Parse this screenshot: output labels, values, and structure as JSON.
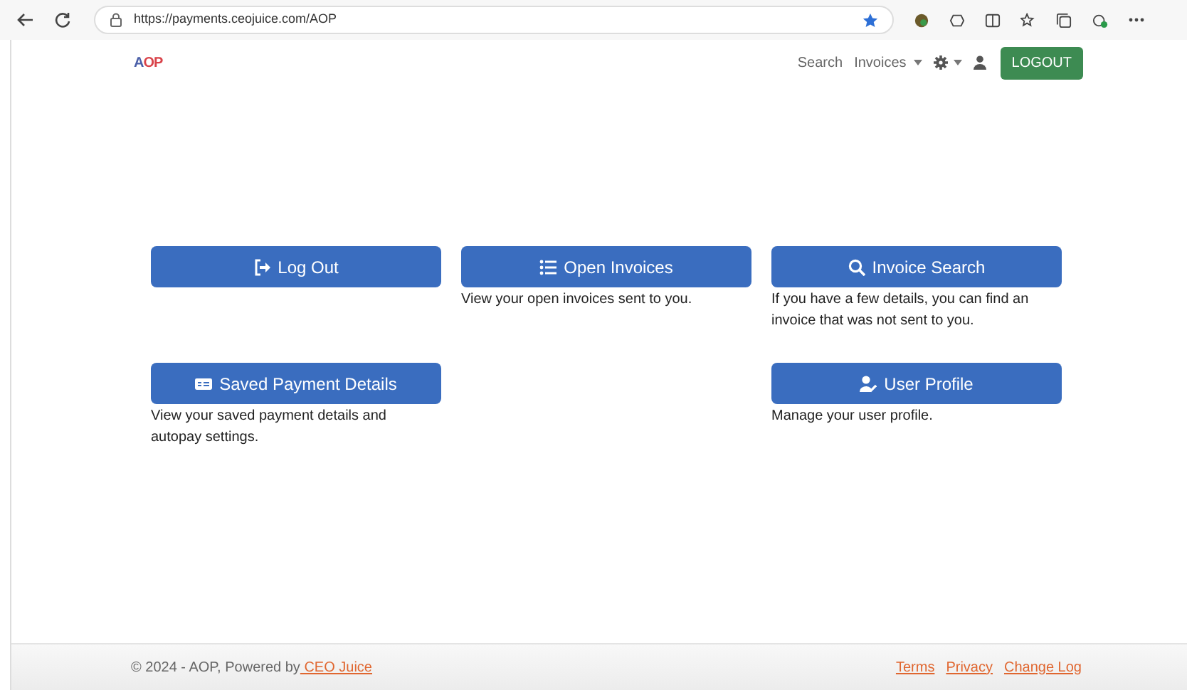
{
  "browser": {
    "url": "https://payments.ceojuice.com/AOP"
  },
  "header": {
    "logo": "AOP",
    "nav": [
      {
        "label": "Search",
        "dropdown": false
      },
      {
        "label": "Invoices",
        "dropdown": true
      }
    ],
    "logout_button": "LOGOUT"
  },
  "tile_rows": [
    {
      "tiles": [
        {
          "label": "Log Out"
        },
        {
          "label": "Open Invoices",
          "description": "View your open invoices sent to you."
        },
        {
          "label": "Invoice Search",
          "description": "If you have a few details, you can find an invoice that was not sent to you."
        }
      ]
    },
    {
      "tiles": [
        {
          "label": "Saved Payment Details",
          "description": "View your saved payment details and autopay settings."
        },
        {
          "label": "User Profile",
          "description": "Manage your user profile."
        }
      ]
    }
  ],
  "footer": {
    "text": "© 2024 - AOP, Powered by",
    "link": " CEO Juice",
    "links": [
      "Terms",
      "Privacy",
      "Change Log"
    ]
  }
}
